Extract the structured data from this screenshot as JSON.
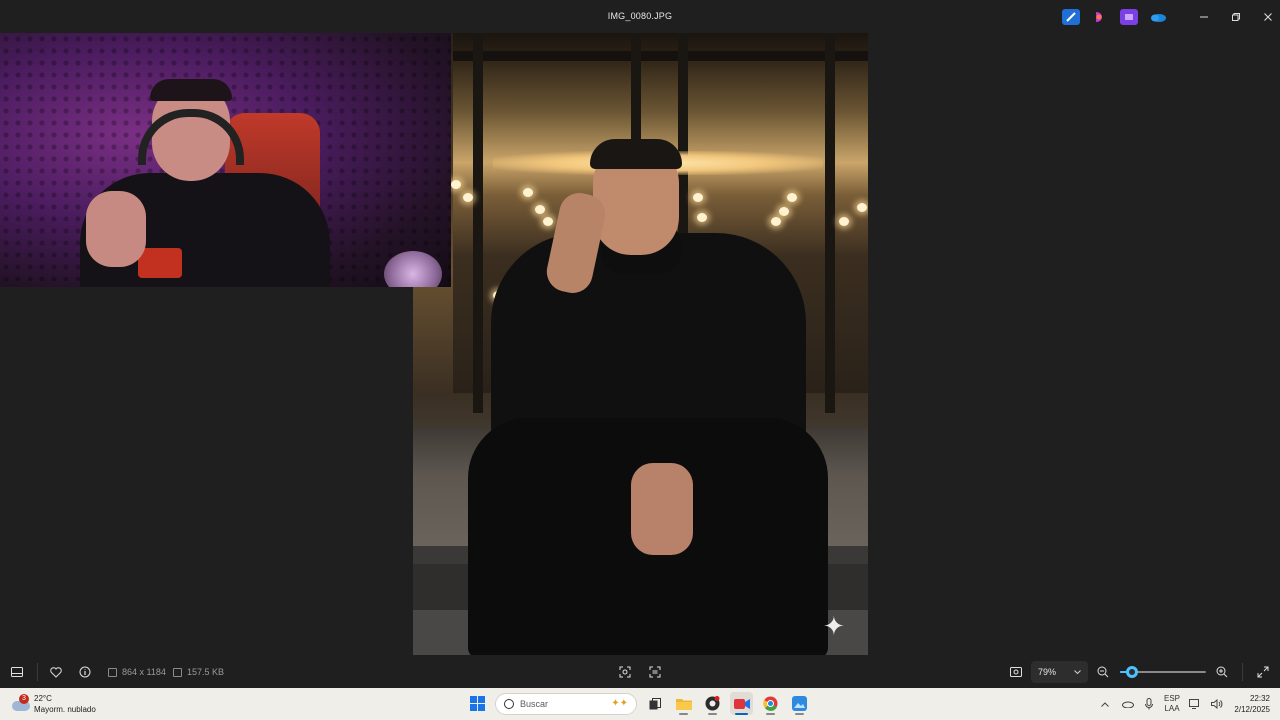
{
  "window": {
    "title": "IMG_0080.JPG",
    "app_icons": [
      "edit-image-icon",
      "clipchamp-icon",
      "movie-editor-icon",
      "onedrive-icon"
    ],
    "controls": [
      "minimize-icon",
      "restore-icon",
      "close-icon"
    ]
  },
  "toolbar": {
    "dimensions": "864 x 1184",
    "file_size": "157.5 KB",
    "zoom_level": "79%",
    "zoom_slider_fraction": 0.14,
    "accent_color": "#4cc2ff"
  },
  "taskbar": {
    "weather": {
      "temperature": "22°C",
      "condition": "Mayorm. nublado",
      "badge_count": "3"
    },
    "search_placeholder": "Buscar",
    "language_line1": "ESP",
    "language_line2": "LAA",
    "time": "22:32",
    "date": "2/12/2025"
  }
}
